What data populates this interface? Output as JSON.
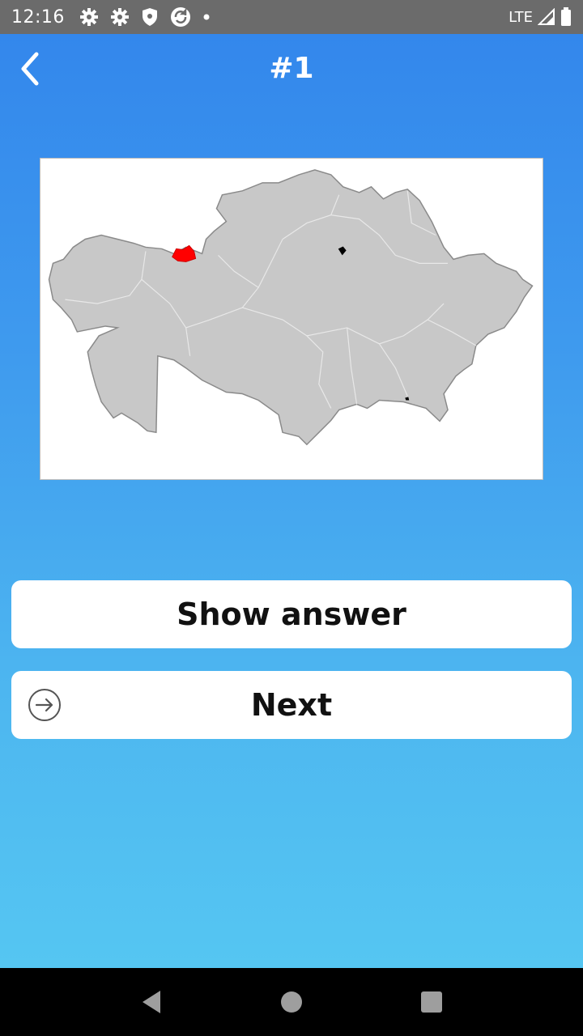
{
  "status_bar": {
    "time": "12:16",
    "network": "LTE",
    "icons": [
      "settings-icon",
      "settings-icon",
      "shield-icon",
      "sync-icon",
      "dot-icon"
    ]
  },
  "toolbar": {
    "back_icon": "chevron-left-icon",
    "title": "#1"
  },
  "map": {
    "subject": "Kazakhstan",
    "highlight_color": "#ff0000",
    "fill_color": "#c8c8c8",
    "border_color": "#8a8a8a"
  },
  "buttons": {
    "show_answer": "Show answer",
    "next": "Next",
    "next_icon": "arrow-right-circle-icon"
  },
  "navigation_bar": {
    "icons": [
      "back-triangle-icon",
      "home-circle-icon",
      "recents-square-icon"
    ]
  },
  "colors": {
    "gradient_top": "#3387ec",
    "gradient_bottom": "#55c6f2",
    "status_bar_bg": "#6b6b6b"
  }
}
